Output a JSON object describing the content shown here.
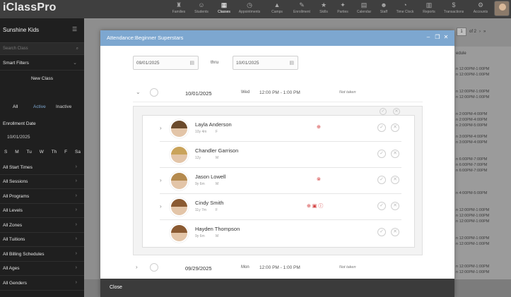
{
  "app": {
    "logo": "iClassPro"
  },
  "nav": [
    {
      "label": "Families",
      "icon": "♜"
    },
    {
      "label": "Students",
      "icon": "☺"
    },
    {
      "label": "Classes",
      "icon": "▦",
      "active": true
    },
    {
      "label": "Appointments",
      "icon": "◷"
    },
    {
      "label": "Camps",
      "icon": "▲"
    },
    {
      "label": "Enrollment",
      "icon": "✎"
    },
    {
      "label": "Skills",
      "icon": "★"
    },
    {
      "label": "Parties",
      "icon": "✦"
    },
    {
      "label": "Calendar",
      "icon": "▤"
    },
    {
      "label": "Staff",
      "icon": "☻"
    },
    {
      "label": "Time Clock",
      "icon": "◔"
    },
    {
      "label": "Reports",
      "icon": "▥"
    },
    {
      "label": "Transactions",
      "icon": "$"
    },
    {
      "label": "Accounts",
      "icon": "⚙"
    }
  ],
  "sidebar": {
    "title": "Sunshine Kids",
    "search_placeholder": "Search Class",
    "smart_filters": "Smart Filters",
    "new_class": "New Class",
    "status": {
      "all": "All",
      "active": "Active",
      "inactive": "Inactive"
    },
    "enrollment_date_label": "Enrollment Date",
    "enrollment_date": "10/01/2025",
    "days": [
      "S",
      "M",
      "Tu",
      "W",
      "Th",
      "F",
      "Sa"
    ],
    "filters": [
      "All Start Times",
      "All Sessions",
      "All Programs",
      "All Levels",
      "All Zones",
      "All Tuitions",
      "All Billing Schedules",
      "All Ages",
      "All Genders"
    ]
  },
  "background": {
    "pager_page": "1",
    "pager_of": "of 2",
    "schedule_label": "edule",
    "times": [
      "n 12:00PM-1:00PM",
      "n 12:00PM-1:00PM",
      "",
      "",
      "n 12:00PM-1:00PM",
      "n 12:00PM-1:00PM",
      "",
      "",
      "n 2:00PM-4:00PM",
      "n 2:00PM-4:00PM",
      "n 2:00PM-5:00PM",
      "",
      "n 3:00PM-4:00PM",
      "n 3:00PM-4:00PM",
      "",
      "",
      "n 6:00PM-7:00PM",
      "n 6:00PM-7:00PM",
      "n 6:00PM-7:00PM",
      "",
      "",
      "",
      "n 4:00PM-5:00PM",
      "",
      "",
      "n 12:00PM-1:00PM",
      "n 12:00PM-1:00PM",
      "n 12:00PM-1:00PM",
      "",
      "",
      "n 12:00PM-1:00PM",
      "n 12:00PM-1:00PM",
      "",
      "",
      "",
      "n 12:00PM-1:00PM",
      "n 12:00PM-1:00PM"
    ]
  },
  "modal": {
    "title": "Attendance:Beginner Superstars",
    "controls": {
      "minimize": "–",
      "restore": "❐",
      "close": "✕"
    },
    "date_from": "09/01/2025",
    "thru_label": "thru",
    "date_to": "10/01/2025",
    "sessions": [
      {
        "date": "10/01/2025",
        "day": "Wed",
        "time": "12:00 PM - 1:00 PM",
        "status": "Not taken"
      },
      {
        "date": "09/29/2025",
        "day": "Mon",
        "time": "12:00 PM - 1:00 PM",
        "status": "Not taken"
      }
    ],
    "students": [
      {
        "name": "Layla Anderson",
        "age": "10y 4m",
        "gender": "F",
        "flags": "⊕",
        "expandable": true
      },
      {
        "name": "Chandler Garrison",
        "age": "12y",
        "gender": "M",
        "flags": "",
        "expandable": false
      },
      {
        "name": "Jason Lowell",
        "age": "9y 6m",
        "gender": "M",
        "flags": "⊗",
        "expandable": true
      },
      {
        "name": "Cindy Smith",
        "age": "11y 7m",
        "gender": "F",
        "flags": "⊕ ▣ ⓘ",
        "expandable": true
      },
      {
        "name": "Hayden Thompson",
        "age": "9y 6m",
        "gender": "M",
        "flags": "",
        "expandable": false
      }
    ],
    "close_label": "Close"
  }
}
